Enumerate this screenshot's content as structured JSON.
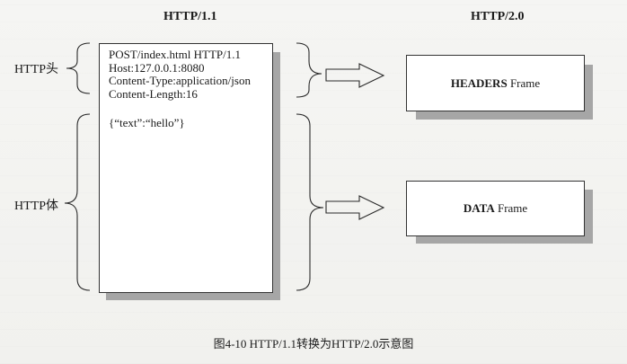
{
  "columns": {
    "left_title": "HTTP/1.1",
    "right_title": "HTTP/2.0"
  },
  "labels": {
    "header_label": "HTTP头",
    "body_label": "HTTP体"
  },
  "http11_message": {
    "header_lines": [
      "POST/index.html HTTP/1.1",
      "Host:127.0.0.1:8080",
      "Content-Type:application/json",
      "Content-Length:16"
    ],
    "body": "{“text”:“hello”}"
  },
  "frames": {
    "headers": {
      "name": "HEADERS",
      "suffix": "Frame"
    },
    "data": {
      "name": "DATA",
      "suffix": "Frame"
    }
  },
  "caption": "图4-10    HTTP/1.1转换为HTTP/2.0示意图"
}
